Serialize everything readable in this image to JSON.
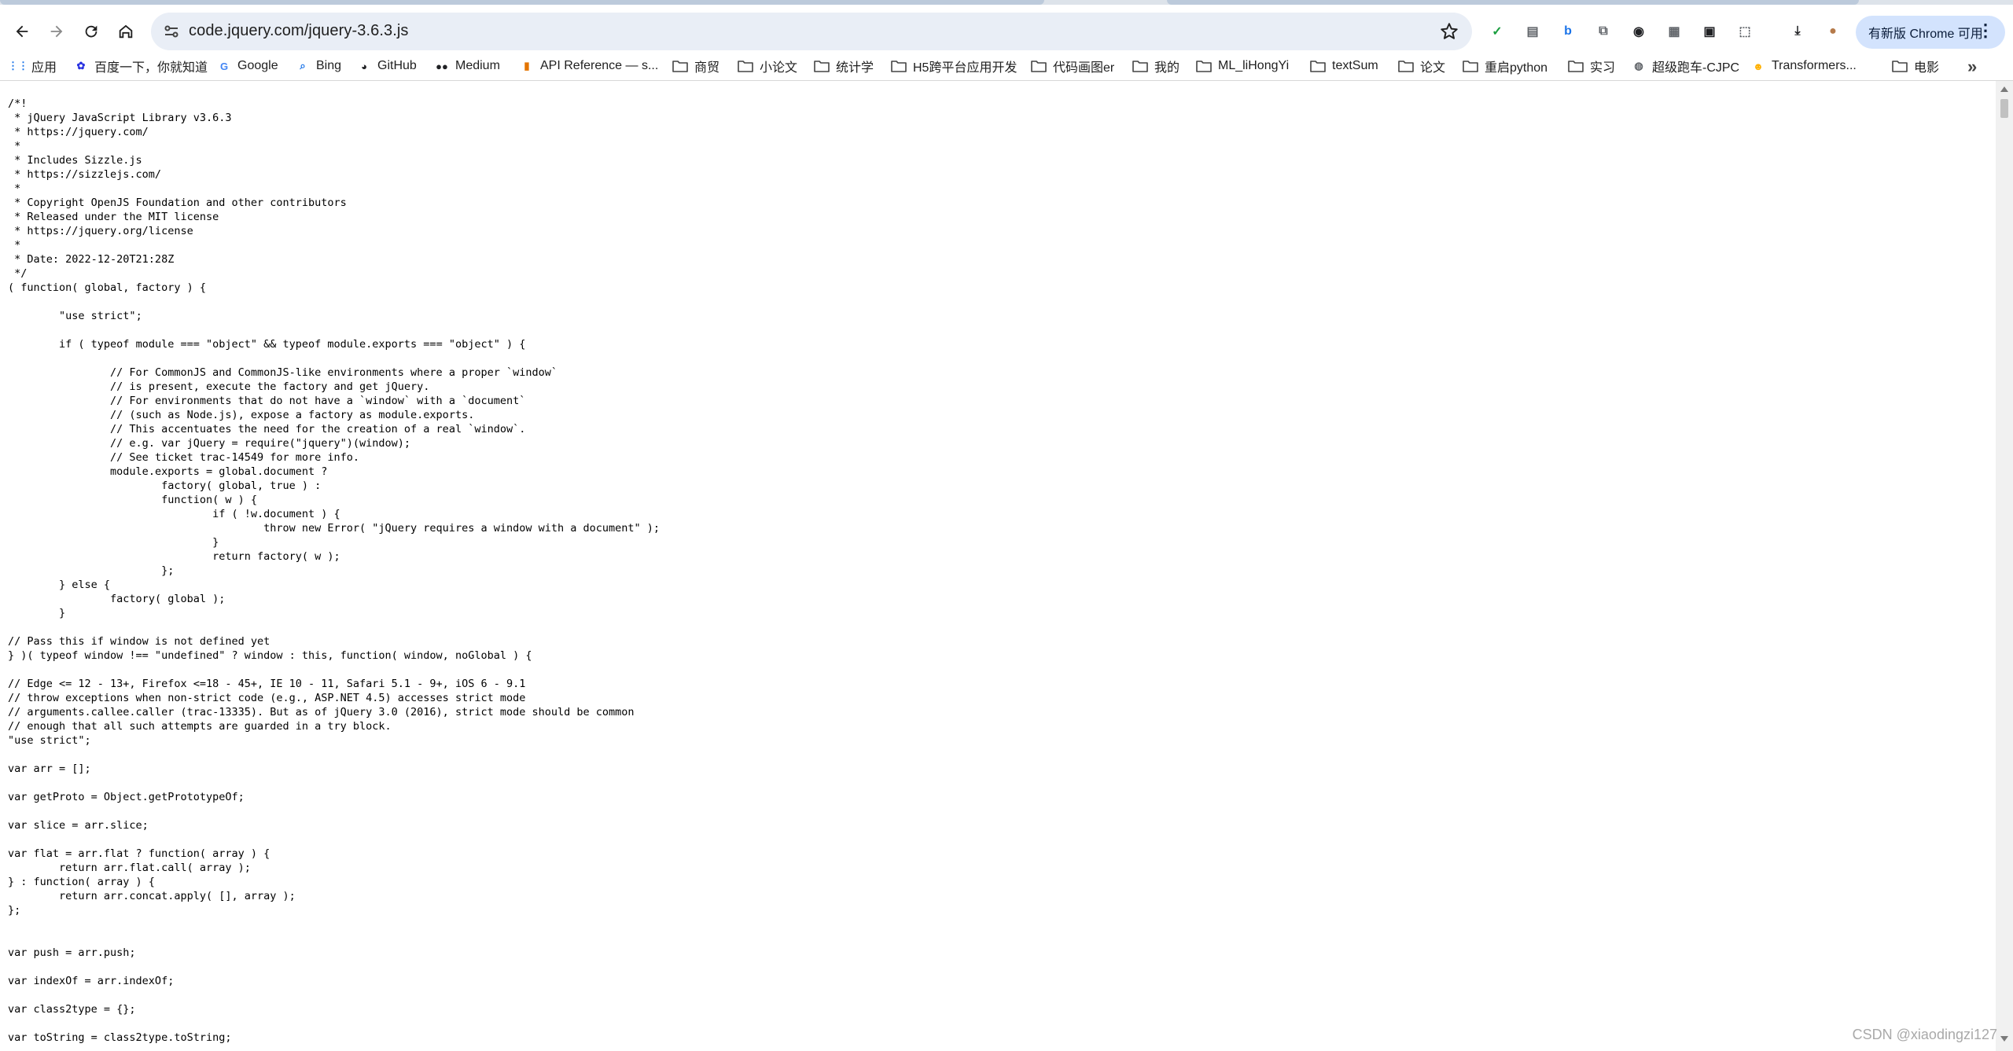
{
  "browser": {
    "url": "code.jquery.com/jquery-3.6.3.js",
    "update_button_label": "有新版 Chrome 可用",
    "extensions": [
      {
        "name": "shield-extension",
        "glyph": "✓",
        "color": "#1a9e3f"
      },
      {
        "name": "notes-extension",
        "glyph": "▤",
        "color": "#5f6368"
      },
      {
        "name": "bing-extension",
        "glyph": "b",
        "color": "#1a73e8"
      },
      {
        "name": "copy-extension",
        "glyph": "⧉",
        "color": "#5f6368"
      },
      {
        "name": "mask-extension",
        "glyph": "◉",
        "color": "#202124"
      },
      {
        "name": "qr-extension",
        "glyph": "▦",
        "color": "#5f6368"
      },
      {
        "name": "counter-extension",
        "glyph": "▣",
        "color": "#202124"
      },
      {
        "name": "puzzle-extension",
        "glyph": "⬚",
        "color": "#5f6368"
      },
      {
        "name": "download-extension",
        "glyph": "⤓",
        "color": "#202124"
      },
      {
        "name": "profile-avatar",
        "glyph": "●",
        "color": "#b57a4a"
      }
    ]
  },
  "bookmarks": [
    {
      "label": "应用",
      "icon": "apps",
      "color": "#1a73e8"
    },
    {
      "label": "百度一下，你就知道",
      "icon": "baidu",
      "color": "#2932e1"
    },
    {
      "label": "Google",
      "icon": "google",
      "color": "#4285f4"
    },
    {
      "label": "Bing",
      "icon": "bing",
      "color": "#1a73e8"
    },
    {
      "label": "GitHub",
      "icon": "github",
      "color": "#202124"
    },
    {
      "label": "Medium",
      "icon": "medium",
      "color": "#202124"
    },
    {
      "label": "API Reference — s...",
      "icon": "chart",
      "color": "#e37400"
    },
    {
      "label": "商贸",
      "icon": "folder"
    },
    {
      "label": "小论文",
      "icon": "folder"
    },
    {
      "label": "统计学",
      "icon": "folder"
    },
    {
      "label": "H5跨平台应用开发",
      "icon": "folder"
    },
    {
      "label": "代码画图er",
      "icon": "folder"
    },
    {
      "label": "我的",
      "icon": "folder"
    },
    {
      "label": "ML_liHongYi",
      "icon": "folder"
    },
    {
      "label": "textSum",
      "icon": "folder"
    },
    {
      "label": "论文",
      "icon": "folder"
    },
    {
      "label": "重启python",
      "icon": "folder"
    },
    {
      "label": "实习",
      "icon": "folder"
    },
    {
      "label": "超级跑车-CJPC",
      "icon": "globe",
      "color": "#5f6368"
    },
    {
      "label": "Transformers...",
      "icon": "hf",
      "color": "#ffb000"
    },
    {
      "label": "电影",
      "icon": "folder"
    }
  ],
  "source_code": "/*!\n * jQuery JavaScript Library v3.6.3\n * https://jquery.com/\n *\n * Includes Sizzle.js\n * https://sizzlejs.com/\n *\n * Copyright OpenJS Foundation and other contributors\n * Released under the MIT license\n * https://jquery.org/license\n *\n * Date: 2022-12-20T21:28Z\n */\n( function( global, factory ) {\n\n\t\"use strict\";\n\n\tif ( typeof module === \"object\" && typeof module.exports === \"object\" ) {\n\n\t\t// For CommonJS and CommonJS-like environments where a proper `window`\n\t\t// is present, execute the factory and get jQuery.\n\t\t// For environments that do not have a `window` with a `document`\n\t\t// (such as Node.js), expose a factory as module.exports.\n\t\t// This accentuates the need for the creation of a real `window`.\n\t\t// e.g. var jQuery = require(\"jquery\")(window);\n\t\t// See ticket trac-14549 for more info.\n\t\tmodule.exports = global.document ?\n\t\t\tfactory( global, true ) :\n\t\t\tfunction( w ) {\n\t\t\t\tif ( !w.document ) {\n\t\t\t\t\tthrow new Error( \"jQuery requires a window with a document\" );\n\t\t\t\t}\n\t\t\t\treturn factory( w );\n\t\t\t};\n\t} else {\n\t\tfactory( global );\n\t}\n\n// Pass this if window is not defined yet\n} )( typeof window !== \"undefined\" ? window : this, function( window, noGlobal ) {\n\n// Edge <= 12 - 13+, Firefox <=18 - 45+, IE 10 - 11, Safari 5.1 - 9+, iOS 6 - 9.1\n// throw exceptions when non-strict code (e.g., ASP.NET 4.5) accesses strict mode\n// arguments.callee.caller (trac-13335). But as of jQuery 3.0 (2016), strict mode should be common\n// enough that all such attempts are guarded in a try block.\n\"use strict\";\n\nvar arr = [];\n\nvar getProto = Object.getPrototypeOf;\n\nvar slice = arr.slice;\n\nvar flat = arr.flat ? function( array ) {\n\treturn arr.flat.call( array );\n} : function( array ) {\n\treturn arr.concat.apply( [], array );\n};\n\n\nvar push = arr.push;\n\nvar indexOf = arr.indexOf;\n\nvar class2type = {};\n\nvar toString = class2type.toString;",
  "watermark": "CSDN @xiaodingzi127"
}
